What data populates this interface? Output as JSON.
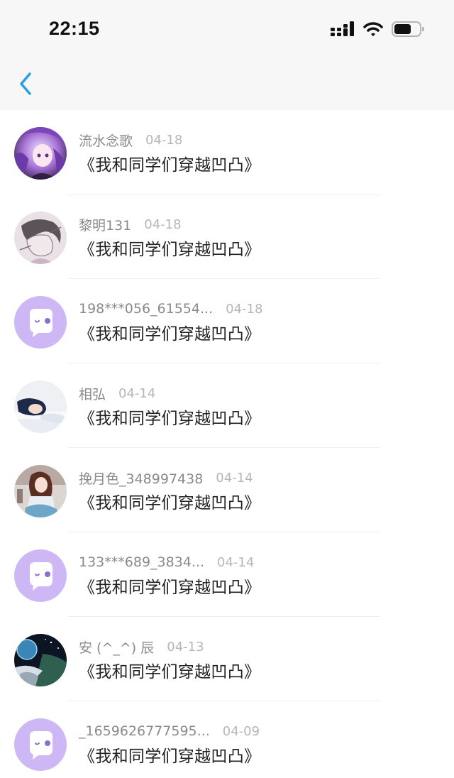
{
  "status_bar": {
    "time": "22:15",
    "signal_icon": "signal-icon",
    "wifi_icon": "wifi-icon",
    "battery_icon": "battery-icon"
  },
  "nav": {
    "back_icon": "back-chevron-icon",
    "accent_color": "#2a9fe3"
  },
  "colors": {
    "default_avatar_bg": "#cdb8f5",
    "username_text": "#8a8a8a",
    "date_text": "#b6b6b6",
    "title_text": "#222222"
  },
  "items": [
    {
      "username": "流水念歌",
      "date": "04-18",
      "title": "《我和同学们穿越凹凸》",
      "avatar": "avatar-anime-purple"
    },
    {
      "username": "黎明131",
      "date": "04-18",
      "title": "《我和同学们穿越凹凸》",
      "avatar": "avatar-sketch"
    },
    {
      "username": "198***056_61554...",
      "date": "04-18",
      "title": "《我和同学们穿越凹凸》",
      "avatar": "default-chat-avatar"
    },
    {
      "username": "相弘",
      "date": "04-14",
      "title": "《我和同学们穿越凹凸》",
      "avatar": "avatar-sleeping"
    },
    {
      "username": "挽月色_348997438",
      "date": "04-14",
      "title": "《我和同学们穿越凹凸》",
      "avatar": "avatar-anime-girl"
    },
    {
      "username": "133***689_3834...",
      "date": "04-14",
      "title": "《我和同学们穿越凹凸》",
      "avatar": "default-chat-avatar"
    },
    {
      "username": "安 (^_^) 辰",
      "date": "04-13",
      "title": "《我和同学们穿越凹凸》",
      "avatar": "avatar-space"
    },
    {
      "username": "_1659626777595...",
      "date": "04-09",
      "title": "《我和同学们穿越凹凸》",
      "avatar": "default-chat-avatar"
    }
  ]
}
